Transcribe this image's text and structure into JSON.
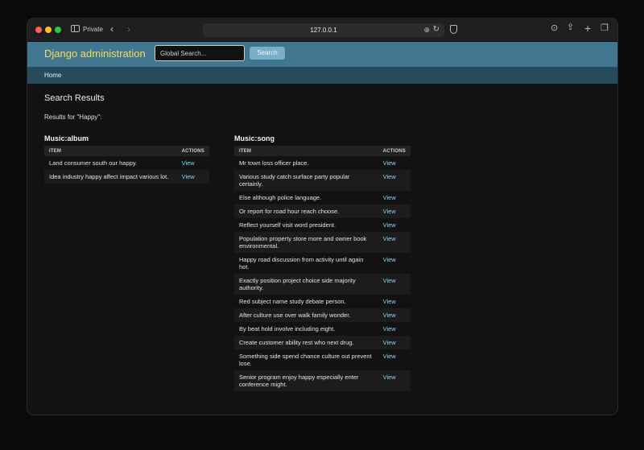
{
  "browser": {
    "private_label": "Private",
    "url": "127.0.0.1"
  },
  "header": {
    "brand": "Django administration",
    "search_placeholder": "Global Search...",
    "search_button": "Search"
  },
  "breadcrumbs": {
    "home": "Home"
  },
  "content": {
    "title": "Search Results",
    "results_for": "Results for \"Happy\":"
  },
  "album": {
    "title": "Music:album",
    "col_item": "ITEM",
    "col_actions": "ACTIONS",
    "rows": [
      {
        "item": "Land consumer south our happy.",
        "action": "View"
      },
      {
        "item": "Idea industry happy affect impact various lot.",
        "action": "View"
      }
    ]
  },
  "song": {
    "title": "Music:song",
    "col_item": "ITEM",
    "col_actions": "ACTIONS",
    "rows": [
      {
        "item": "Mr town loss officer place.",
        "action": "View"
      },
      {
        "item": "Various study catch surface party popular certainly.",
        "action": "View"
      },
      {
        "item": "Else although police language.",
        "action": "View"
      },
      {
        "item": "Or report for road hour reach choose.",
        "action": "View"
      },
      {
        "item": "Reflect yourself visit word president.",
        "action": "View"
      },
      {
        "item": "Population property store more and owner book environmental.",
        "action": "View"
      },
      {
        "item": "Happy road discussion from activity until again hot.",
        "action": "View"
      },
      {
        "item": "Exactly position project choice side majority authority.",
        "action": "View"
      },
      {
        "item": "Red subject name study debate person.",
        "action": "View"
      },
      {
        "item": "After culture use over walk family wonder.",
        "action": "View"
      },
      {
        "item": "By beat hold involve including eight.",
        "action": "View"
      },
      {
        "item": "Create customer ability rest who next drug.",
        "action": "View"
      },
      {
        "item": "Something side spend chance culture out prevent lose.",
        "action": "View"
      },
      {
        "item": "Senior program enjoy happy especially enter conference might.",
        "action": "View"
      }
    ]
  },
  "colors": {
    "header_bg": "#417690",
    "breadcrumb_bg": "#264b5d",
    "brand": "#f5dd5d",
    "link": "#81d4fa",
    "button": "#79aec8"
  }
}
